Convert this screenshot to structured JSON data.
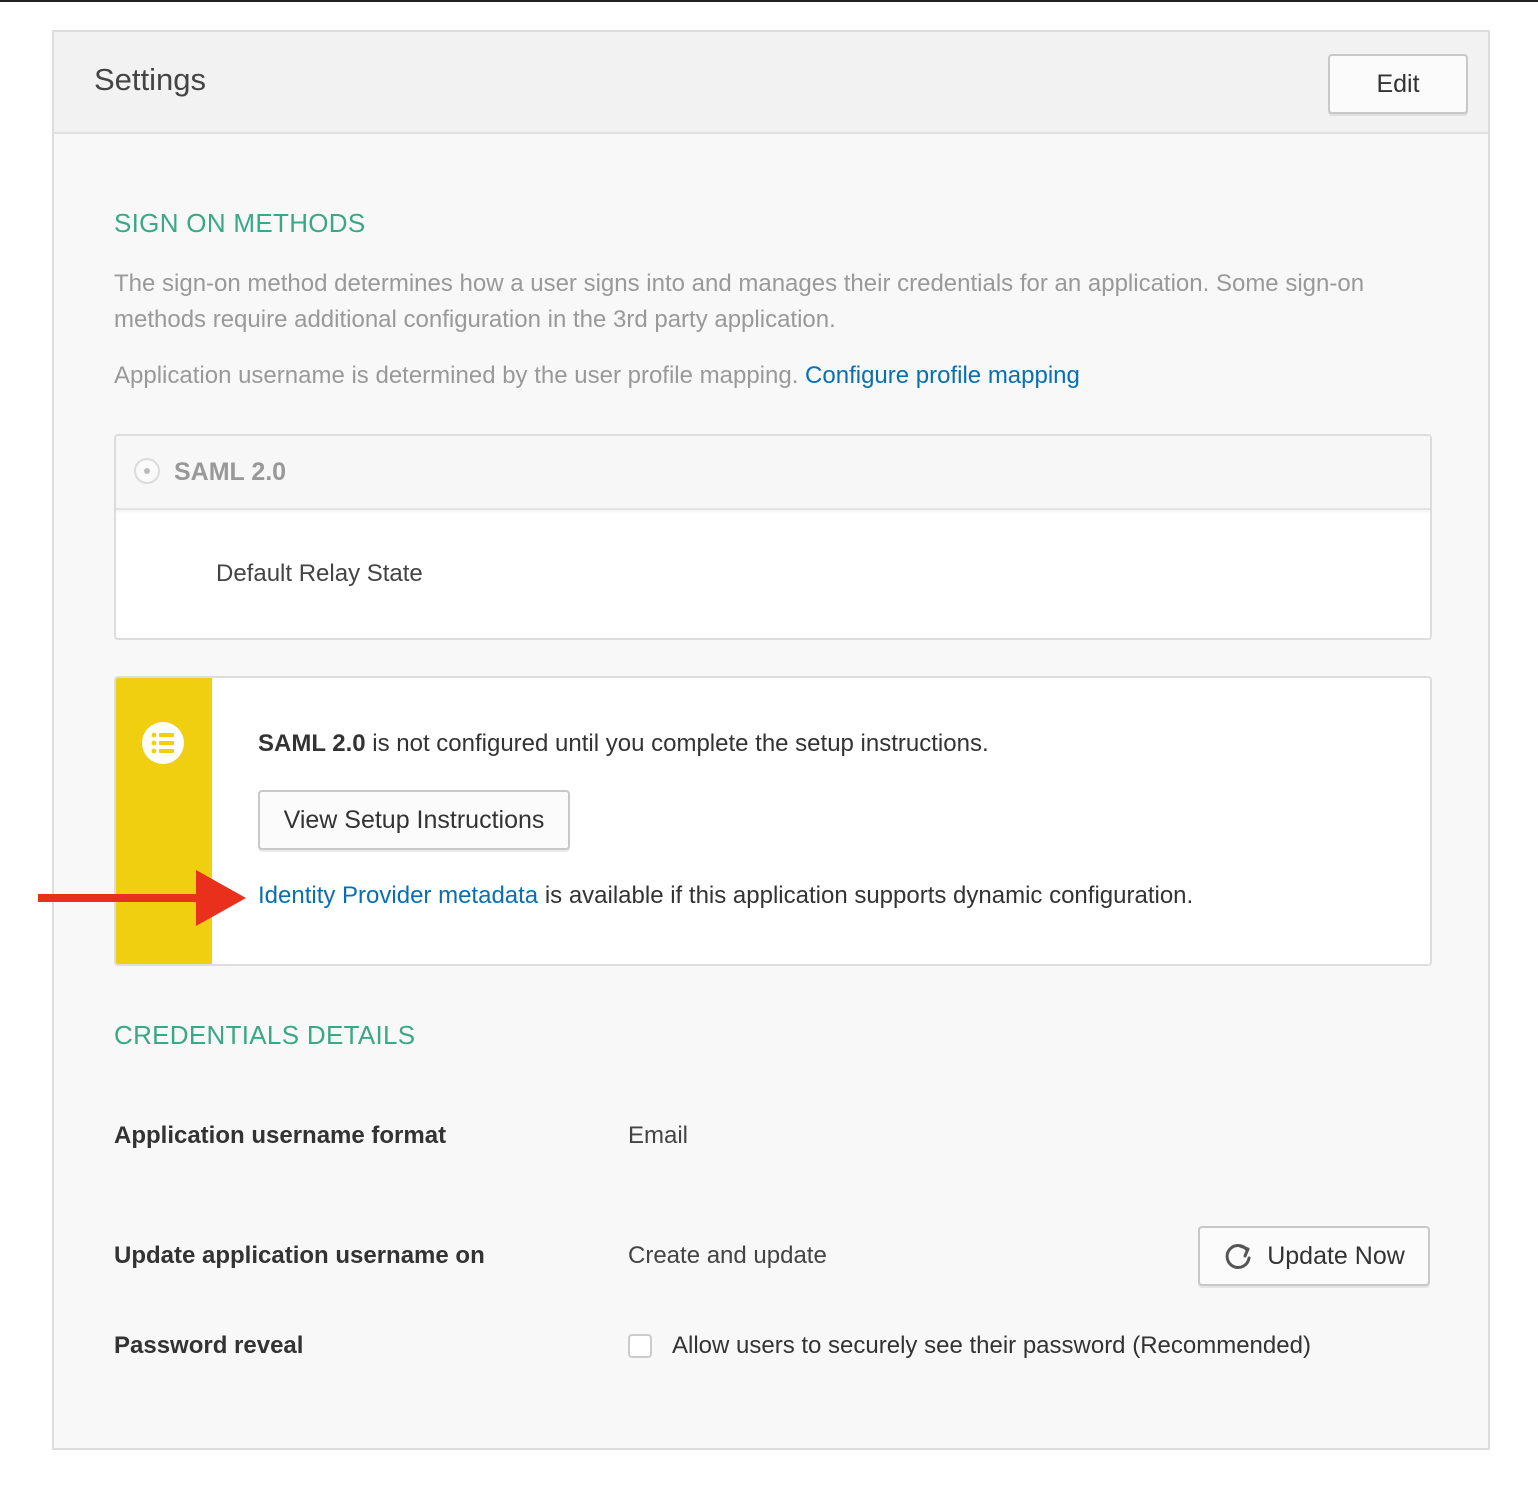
{
  "panel": {
    "title": "Settings",
    "edit_label": "Edit"
  },
  "sign_on": {
    "section_title": "SIGN ON METHODS",
    "description": "The sign-on method determines how a user signs into and manages their credentials for an application. Some sign-on methods require additional configuration in the 3rd party application.",
    "username_note": "Application username is determined by the user profile mapping.",
    "configure_link": "Configure profile mapping",
    "method": {
      "label": "SAML 2.0",
      "relay_state_label": "Default Relay State"
    }
  },
  "notice": {
    "icon": "list-icon",
    "accent_color": "#f0ce10",
    "strong": "SAML 2.0",
    "message": " is not configured until you complete the setup instructions.",
    "button_label": "View Setup Instructions",
    "metadata_link": "Identity Provider metadata",
    "metadata_text": " is available if this application supports dynamic configuration."
  },
  "credentials": {
    "section_title": "CREDENTIALS DETAILS",
    "rows": [
      {
        "label": "Application username format",
        "value": "Email"
      },
      {
        "label": "Update application username on",
        "value": "Create and update"
      },
      {
        "label": "Password reveal",
        "value": "Allow users to securely see their password (Recommended)"
      }
    ],
    "update_button_label": "Update Now",
    "update_icon": "refresh-icon",
    "password_reveal_checked": false
  },
  "colors": {
    "section_title": "#3aa886",
    "link": "#0a6fb0",
    "arrow": "#e8301c"
  }
}
